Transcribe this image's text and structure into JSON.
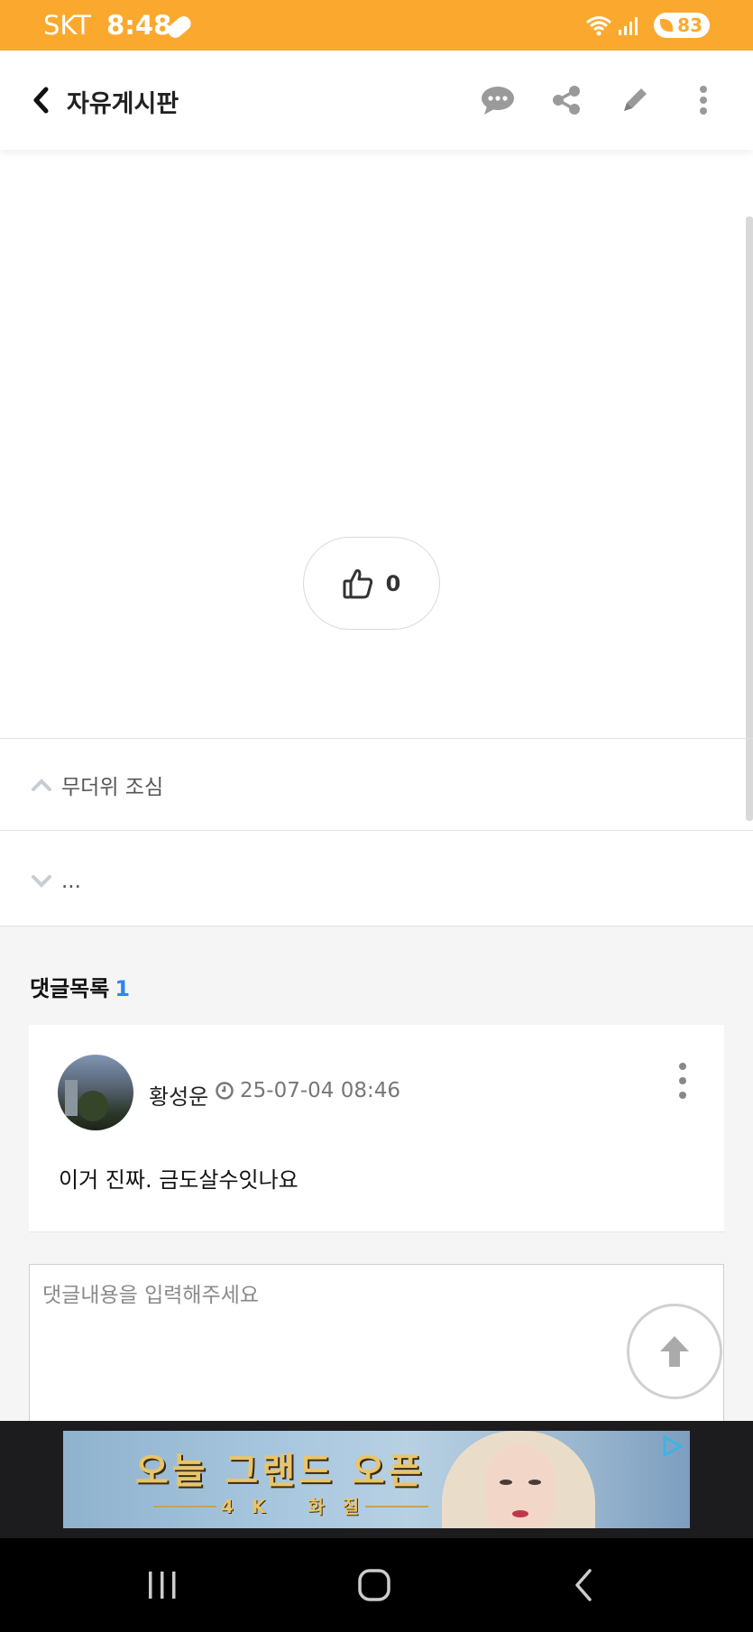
{
  "status_bar": {
    "carrier": "SKT",
    "time": "8:48",
    "battery": "83",
    "color": "#fba92e"
  },
  "header": {
    "title": "자유게시판",
    "icons": [
      "back-icon",
      "chat-icon",
      "share-icon",
      "pencil-icon",
      "more-vertical-icon"
    ]
  },
  "post": {
    "like_count": "0"
  },
  "navigation": {
    "prev_title": "무더위 조심",
    "next_title": "..."
  },
  "comments": {
    "heading": "댓글목록",
    "count": "1",
    "items": [
      {
        "author": "황성운",
        "datetime": "25-07-04 08:46",
        "text": "이거 진짜. 금도살수잇나요"
      }
    ],
    "input_placeholder": "댓글내용을 입력해주세요"
  },
  "ad": {
    "title": "오늘 그랜드 오픈",
    "subtitle": "4K 화질"
  },
  "colors": {
    "accent": "#fba92e",
    "count_blue": "#2f86e9"
  }
}
